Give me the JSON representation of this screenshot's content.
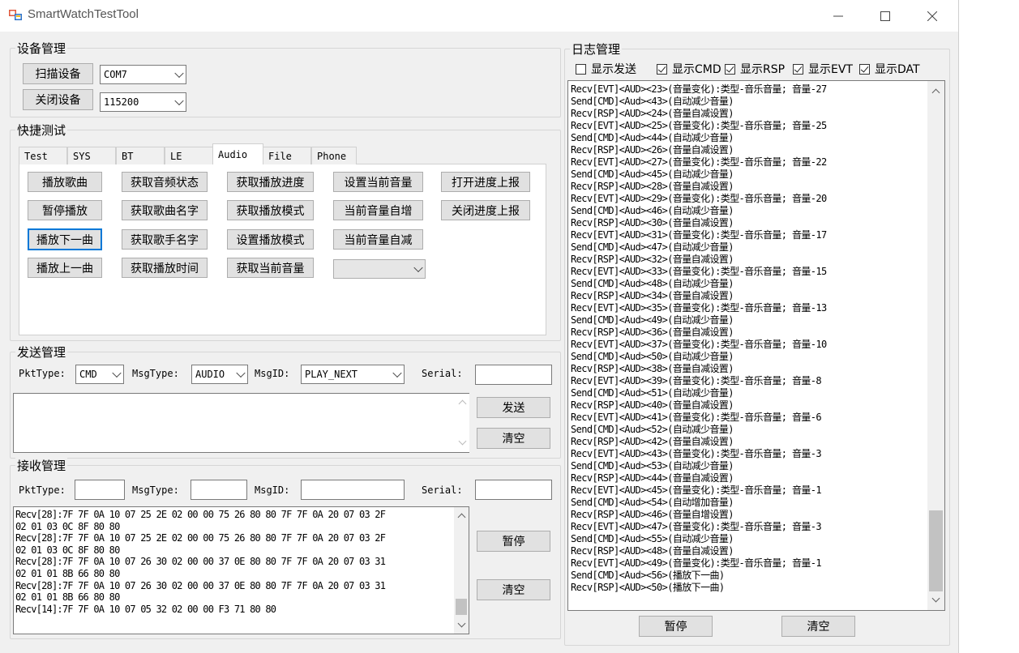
{
  "window": {
    "title": "SmartWatchTestTool"
  },
  "device_mgmt": {
    "title": "设备管理",
    "scan_button": "扫描设备",
    "close_button": "关闭设备",
    "port": "COM7",
    "baud": "115200"
  },
  "quick_test": {
    "title": "快捷测试",
    "tabs": [
      "Test",
      "SYS",
      "BT",
      "LE",
      "Audio",
      "File",
      "Phone"
    ],
    "active_tab": "Audio",
    "buttons": [
      [
        "播放歌曲",
        "获取音频状态",
        "获取播放进度",
        "设置当前音量",
        "打开进度上报"
      ],
      [
        "暂停播放",
        "获取歌曲名字",
        "获取播放模式",
        "当前音量自增",
        "关闭进度上报"
      ],
      [
        "播放下一曲",
        "获取歌手名字",
        "设置播放模式",
        "当前音量自减"
      ],
      [
        "播放上一曲",
        "获取播放时间",
        "获取当前音量"
      ]
    ],
    "select_value": ""
  },
  "send_mgmt": {
    "title": "发送管理",
    "pkt_type_label": "PktType:",
    "pkt_type": "CMD",
    "msg_type_label": "MsgType:",
    "msg_type": "AUDIO",
    "msg_id_label": "MsgID:",
    "msg_id": "PLAY_NEXT",
    "serial_label": "Serial:",
    "serial": "",
    "payload": "",
    "send_button": "发送",
    "clear_button": "清空"
  },
  "recv_mgmt": {
    "title": "接收管理",
    "pkt_type_label": "PktType:",
    "msg_type_label": "MsgType:",
    "msg_id_label": "MsgID:",
    "serial_label": "Serial:",
    "pkt_type": "",
    "msg_type": "",
    "msg_id": "",
    "serial": "",
    "log": "Recv[28]:7F 7F 0A 10 07 25 2E 02 00 00 75 26 80 80 7F 7F 0A 20 07 03 2F\n02 01 03 0C 8F 80 80\nRecv[28]:7F 7F 0A 10 07 25 2E 02 00 00 75 26 80 80 7F 7F 0A 20 07 03 2F\n02 01 03 0C 8F 80 80\nRecv[28]:7F 7F 0A 10 07 26 30 02 00 00 37 0E 80 80 7F 7F 0A 20 07 03 31\n02 01 01 8B 66 80 80\nRecv[28]:7F 7F 0A 10 07 26 30 02 00 00 37 0E 80 80 7F 7F 0A 20 07 03 31\n02 01 01 8B 66 80 80\nRecv[14]:7F 7F 0A 10 07 05 32 02 00 00 F3 71 80 80",
    "pause_button": "暂停",
    "clear_button": "清空"
  },
  "log_mgmt": {
    "title": "日志管理",
    "filters": [
      {
        "label": "显示发送",
        "checked": false
      },
      {
        "label": "显示CMD",
        "checked": true
      },
      {
        "label": "显示RSP",
        "checked": true
      },
      {
        "label": "显示EVT",
        "checked": true
      },
      {
        "label": "显示DAT",
        "checked": true
      }
    ],
    "log": "Recv[EVT]<AUD><23>(音量变化):类型-音乐音量; 音量-27\nSend[CMD]<Aud><43>(自动减少音量)\nRecv[RSP]<AUD><24>(音量自减设置)\nRecv[EVT]<AUD><25>(音量变化):类型-音乐音量; 音量-25\nSend[CMD]<Aud><44>(自动减少音量)\nRecv[RSP]<AUD><26>(音量自减设置)\nRecv[EVT]<AUD><27>(音量变化):类型-音乐音量; 音量-22\nSend[CMD]<Aud><45>(自动减少音量)\nRecv[RSP]<AUD><28>(音量自减设置)\nRecv[EVT]<AUD><29>(音量变化):类型-音乐音量; 音量-20\nSend[CMD]<Aud><46>(自动减少音量)\nRecv[RSP]<AUD><30>(音量自减设置)\nRecv[EVT]<AUD><31>(音量变化):类型-音乐音量; 音量-17\nSend[CMD]<Aud><47>(自动减少音量)\nRecv[RSP]<AUD><32>(音量自减设置)\nRecv[EVT]<AUD><33>(音量变化):类型-音乐音量; 音量-15\nSend[CMD]<Aud><48>(自动减少音量)\nRecv[RSP]<AUD><34>(音量自减设置)\nRecv[EVT]<AUD><35>(音量变化):类型-音乐音量; 音量-13\nSend[CMD]<Aud><49>(自动减少音量)\nRecv[RSP]<AUD><36>(音量自减设置)\nRecv[EVT]<AUD><37>(音量变化):类型-音乐音量; 音量-10\nSend[CMD]<Aud><50>(自动减少音量)\nRecv[RSP]<AUD><38>(音量自减设置)\nRecv[EVT]<AUD><39>(音量变化):类型-音乐音量; 音量-8\nSend[CMD]<Aud><51>(自动减少音量)\nRecv[RSP]<AUD><40>(音量自减设置)\nRecv[EVT]<AUD><41>(音量变化):类型-音乐音量; 音量-6\nSend[CMD]<Aud><52>(自动减少音量)\nRecv[RSP]<AUD><42>(音量自减设置)\nRecv[EVT]<AUD><43>(音量变化):类型-音乐音量; 音量-3\nSend[CMD]<Aud><53>(自动减少音量)\nRecv[RSP]<AUD><44>(音量自减设置)\nRecv[EVT]<AUD><45>(音量变化):类型-音乐音量; 音量-1\nSend[CMD]<Aud><54>(自动增加音量)\nRecv[RSP]<AUD><46>(音量自增设置)\nRecv[EVT]<AUD><47>(音量变化):类型-音乐音量; 音量-3\nSend[CMD]<Aud><55>(自动减少音量)\nRecv[RSP]<AUD><48>(音量自减设置)\nRecv[EVT]<AUD><49>(音量变化):类型-音乐音量; 音量-1\nSend[CMD]<Aud><56>(播放下一曲)\nRecv[RSP]<AUD><50>(播放下一曲)",
    "pause_button": "暂停",
    "clear_button": "清空"
  },
  "icons": {
    "app": "app-window-icon",
    "minimize": "minimize-icon",
    "maximize": "maximize-icon",
    "close": "close-icon"
  }
}
